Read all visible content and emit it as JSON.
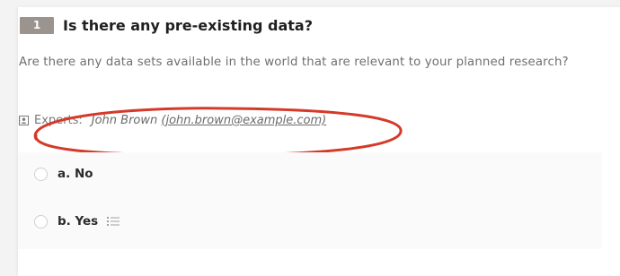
{
  "question": {
    "number": "1",
    "title": "Is there any pre-existing data?",
    "text": "Are there any data sets available in the world that are relevant to your planned research?"
  },
  "experts": {
    "label": "Experts:",
    "name": "John Brown",
    "email_display": "(john.brown@example.com)"
  },
  "answers": [
    {
      "label": "a. No"
    },
    {
      "label": "b. Yes"
    }
  ],
  "colors": {
    "number_badge": "#9a938e",
    "highlight": "#d43a2a"
  },
  "icons": {
    "experts": "address-card-icon",
    "follow_up": "list-icon"
  }
}
